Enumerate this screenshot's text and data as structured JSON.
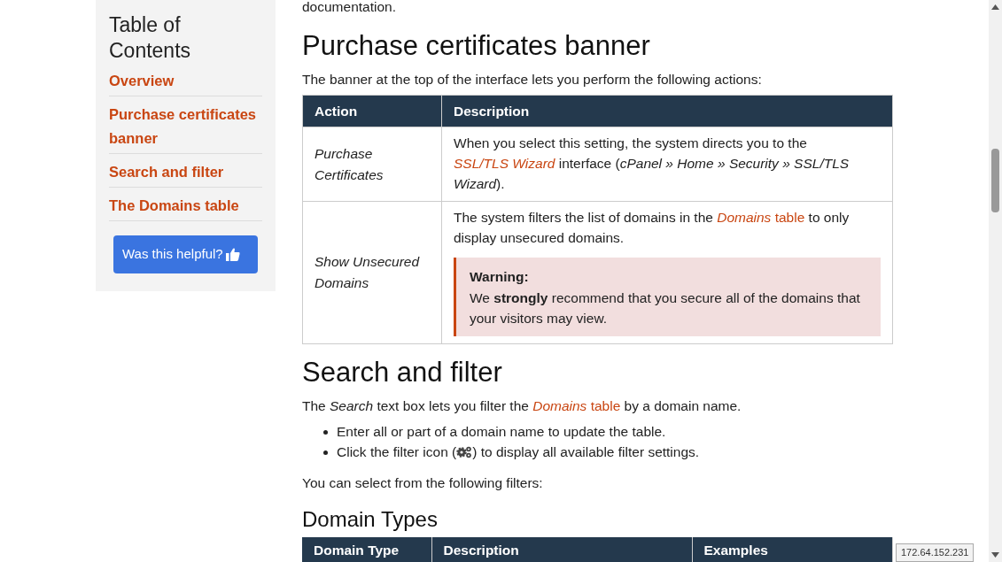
{
  "toc": {
    "title": "Table of Contents",
    "items": [
      {
        "label": "Overview"
      },
      {
        "label": "Purchase certificates banner"
      },
      {
        "label": "Search and filter"
      },
      {
        "label": "The Domains table"
      }
    ],
    "feedback_button": "Was this helpful?"
  },
  "content": [
    {
      "kind": "para",
      "parts": [
        {
          "kind": "text",
          "text": "documentation."
        }
      ]
    },
    {
      "kind": "heading",
      "text": "Purchase certificates banner"
    },
    {
      "kind": "para",
      "parts": [
        {
          "kind": "text",
          "text": "The banner at the top of the interface lets you perform the following actions:"
        }
      ]
    },
    {
      "kind": "table",
      "columns": [
        "Action",
        "Description"
      ],
      "rows": [
        {
          "action": "Purchase Certificates",
          "blocks": [
            {
              "kind": "para",
              "parts": [
                {
                  "kind": "text",
                  "text": "When you select this setting, the system directs you to the "
                },
                {
                  "kind": "link",
                  "text": "*SSL/TLS Wizard*"
                },
                {
                  "kind": "text",
                  "text": " interface (*cPanel » Home » Security » SSL/TLS Wizard*)."
                }
              ]
            }
          ]
        },
        {
          "action": "Show Unsecured Domains",
          "blocks": [
            {
              "kind": "para",
              "parts": [
                {
                  "kind": "text",
                  "text": "The system filters the list of domains in the "
                },
                {
                  "kind": "link",
                  "text": "*Domains* table"
                },
                {
                  "kind": "text",
                  "text": " to only display unsecured domains."
                }
              ]
            },
            {
              "kind": "warning",
              "title": "Warning:",
              "text": "We **strongly** recommend that you secure all of the domains that your visitors may view."
            }
          ]
        }
      ]
    },
    {
      "kind": "heading",
      "text": "Search and filter"
    },
    {
      "kind": "para",
      "parts": [
        {
          "kind": "text",
          "text": "The *Search* text box lets you filter the "
        },
        {
          "kind": "link",
          "text": "*Domains* table"
        },
        {
          "kind": "text",
          "text": " by a domain name."
        }
      ]
    },
    {
      "kind": "list",
      "items": [
        {
          "parts": [
            {
              "kind": "text",
              "text": "Enter all or part of a domain name to update the table."
            }
          ]
        },
        {
          "parts": [
            {
              "kind": "text",
              "text": "Click the filter icon ("
            },
            {
              "kind": "gear"
            },
            {
              "kind": "text",
              "text": ") to display all available filter settings."
            }
          ]
        }
      ]
    },
    {
      "kind": "para",
      "parts": [
        {
          "kind": "text",
          "text": "You can select from the following filters:"
        }
      ]
    },
    {
      "kind": "subheading",
      "text": "Domain Types"
    },
    {
      "kind": "table_head",
      "columns": [
        "Domain Type",
        "Description",
        "Examples"
      ]
    }
  ],
  "ip_badge": "172.64.152.231"
}
